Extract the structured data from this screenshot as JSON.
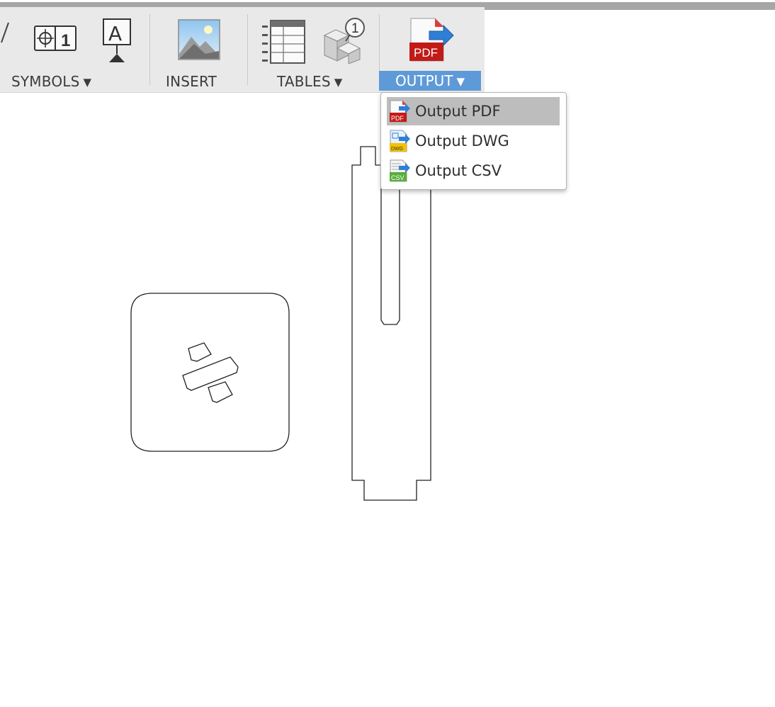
{
  "toolbar": {
    "symbols_label": "SYMBOLS",
    "insert_label": "INSERT",
    "tables_label": "TABLES",
    "output_label": "OUTPUT",
    "dropdown_arrow": "▼",
    "balloon_badge": "1",
    "datum_symbol_text": "1",
    "text_tool_glyph": "A",
    "pdf_icon_text": "PDF"
  },
  "output_menu": {
    "items": [
      {
        "label": "Output PDF",
        "icon": "pdf-icon",
        "icon_text": "PDF",
        "highlighted": true
      },
      {
        "label": "Output DWG",
        "icon": "dwg-icon",
        "icon_text": "DWG",
        "highlighted": false
      },
      {
        "label": "Output CSV",
        "icon": "csv-icon",
        "icon_text": "CSV",
        "highlighted": false
      }
    ]
  },
  "colors": {
    "toolbar_bg": "#e9e9e9",
    "active_group_bg": "#5e9ad7",
    "menu_highlight": "#bdbdbd",
    "pdf_red": "#c21b17",
    "arrow_blue": "#2f7fd6"
  }
}
